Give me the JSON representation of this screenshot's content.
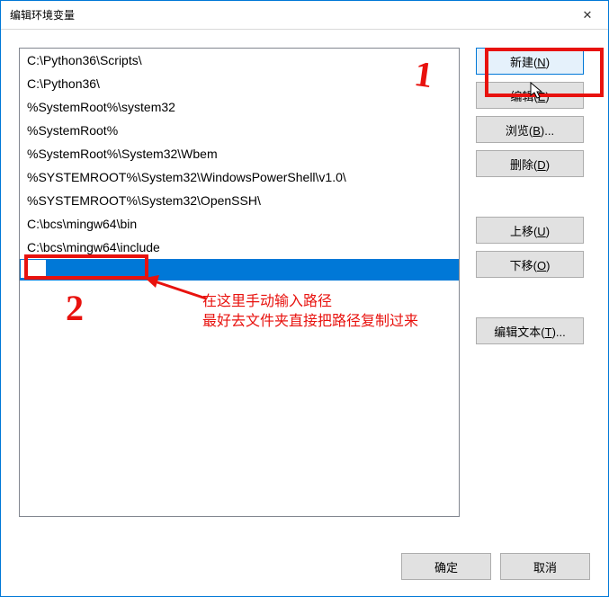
{
  "window": {
    "title": "编辑环境变量"
  },
  "list": {
    "items": [
      "C:\\Python36\\Scripts\\",
      "C:\\Python36\\",
      "%SystemRoot%\\system32",
      "%SystemRoot%",
      "%SystemRoot%\\System32\\Wbem",
      "%SYSTEMROOT%\\System32\\WindowsPowerShell\\v1.0\\",
      "%SYSTEMROOT%\\System32\\OpenSSH\\",
      "C:\\bcs\\mingw64\\bin",
      "C:\\bcs\\mingw64\\include"
    ],
    "editing_value": ""
  },
  "buttons": {
    "new": "新建(N)",
    "edit": "编辑(E)",
    "browse": "浏览(B)...",
    "delete": "删除(D)",
    "moveup": "上移(U)",
    "movedown": "下移(O)",
    "edittext": "编辑文本(T)...",
    "ok": "确定",
    "cancel": "取消"
  },
  "annotations": {
    "num1": "1",
    "num2": "2",
    "hint": "在这里手动输入路径\n最好去文件夹直接把路径复制过来"
  }
}
